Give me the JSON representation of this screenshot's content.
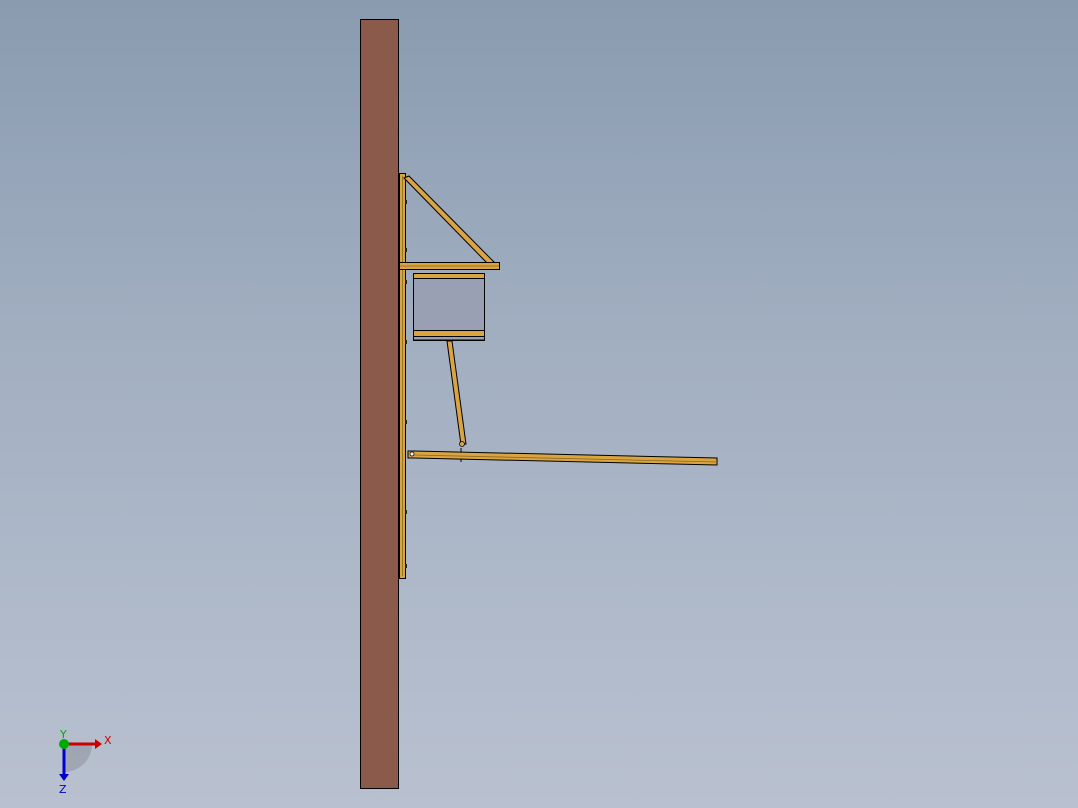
{
  "viewport": {
    "background_top": "#8a9bb0",
    "background_bottom": "#b9c1d0"
  },
  "model": {
    "pole_color": "#8b5a4b",
    "steel_color": "#d9a441",
    "panel_color": "#9aa0b4"
  },
  "triad": {
    "x_label": "X",
    "y_label": "Y",
    "z_label": "Z",
    "x_color": "#cc0000",
    "y_color": "#00aa00",
    "z_color": "#0000cc"
  }
}
